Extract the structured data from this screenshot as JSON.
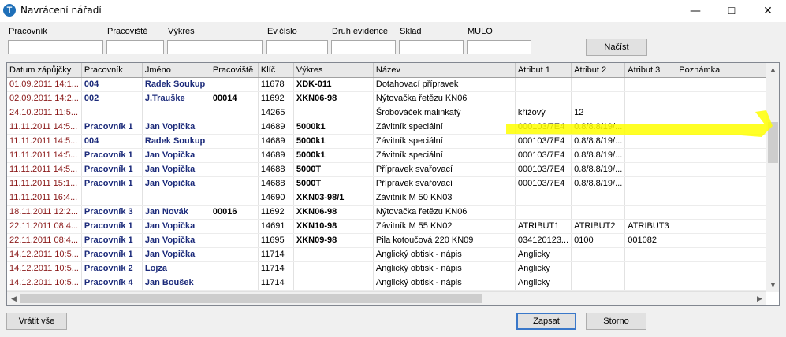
{
  "window": {
    "title": "Navrácení nářadí",
    "app_icon": "tool-app-icon",
    "minimize": "—",
    "maximize": "☐",
    "close": "✕"
  },
  "filters": {
    "pracovnik": {
      "label": "Pracovník",
      "value": ""
    },
    "pracoviste": {
      "label": "Pracoviště",
      "value": ""
    },
    "vykres": {
      "label": "Výkres",
      "value": ""
    },
    "evcislo": {
      "label": "Ev.číslo",
      "value": ""
    },
    "druh": {
      "label": "Druh evidence",
      "value": ""
    },
    "sklad": {
      "label": "Sklad",
      "value": ""
    },
    "mulo": {
      "label": "MULO",
      "value": ""
    },
    "load_button": "Načíst"
  },
  "grid": {
    "columns": [
      "Datum zápůjčky",
      "Pracovník",
      "Jméno",
      "Pracoviště",
      "Klíč",
      "Výkres",
      "Název",
      "Atribut 1",
      "Atribut 2",
      "Atribut 3",
      "Poznámka"
    ],
    "rows": [
      [
        "01.09.2011 14:1...",
        "004",
        "Radek Soukup",
        "",
        "11678",
        "XDK-011",
        "Dotahovací přípravek",
        "",
        "",
        "",
        ""
      ],
      [
        "02.09.2011 14:2...",
        "002",
        "J.Trauške",
        "00014",
        "11692",
        "XKN06-98",
        "Nýtovačka řetězu KN06",
        "",
        "",
        "",
        ""
      ],
      [
        "24.10.2011 11:5...",
        "",
        "",
        "",
        "14265",
        "",
        "Šrobováček malinkatý",
        "křížový",
        "12",
        "",
        ""
      ],
      [
        "11.11.2011 14:5...",
        "Pracovník 1",
        "Jan Vopička",
        "",
        "14689",
        "5000k1",
        "Závitník speciální",
        "000103/7E4",
        "0.8/8.8/19/...",
        "",
        ""
      ],
      [
        "11.11.2011 14:5...",
        "004",
        "Radek Soukup",
        "",
        "14689",
        "5000k1",
        "Závitník speciální",
        "000103/7E4",
        "0.8/8.8/19/...",
        "",
        ""
      ],
      [
        "11.11.2011 14:5...",
        "Pracovník 1",
        "Jan Vopička",
        "",
        "14689",
        "5000k1",
        "Závitník speciální",
        "000103/7E4",
        "0.8/8.8/19/...",
        "",
        ""
      ],
      [
        "11.11.2011 14:5...",
        "Pracovník 1",
        "Jan Vopička",
        "",
        "14688",
        "5000T",
        "Přípravek svařovací",
        "000103/7E4",
        "0.8/8.8/19/...",
        "",
        ""
      ],
      [
        "11.11.2011 15:1...",
        "Pracovník 1",
        "Jan Vopička",
        "",
        "14688",
        "5000T",
        "Přípravek svařovací",
        "000103/7E4",
        "0.8/8.8/19/...",
        "",
        ""
      ],
      [
        "11.11.2011 16:4...",
        "",
        "",
        "",
        "14690",
        "XKN03-98/1",
        "Závitník M 50 KN03",
        "",
        "",
        "",
        ""
      ],
      [
        "18.11.2011 12:2...",
        "Pracovník 3",
        "Jan Novák",
        "00016",
        "11692",
        "XKN06-98",
        "Nýtovačka řetězu KN06",
        "",
        "",
        "",
        ""
      ],
      [
        "22.11.2011 08:4...",
        "Pracovník 1",
        "Jan Vopička",
        "",
        "14691",
        "XKN10-98",
        "Závitník M 55 KN02",
        "ATRIBUT1",
        "ATRIBUT2",
        "ATRIBUT3",
        ""
      ],
      [
        "22.11.2011 08:4...",
        "Pracovník 1",
        "Jan Vopička",
        "",
        "11695",
        "XKN09-98",
        "Pila kotoučová 220 KN09",
        "034120123...",
        "0100",
        "001082",
        ""
      ],
      [
        "14.12.2011 10:5...",
        "Pracovník 1",
        "Jan Vopička",
        "",
        "11714",
        "",
        "Anglický obtisk - nápis",
        "Anglicky",
        "",
        "",
        ""
      ],
      [
        "14.12.2011 10:5...",
        "Pracovník 2",
        "Lojza",
        "",
        "11714",
        "",
        "Anglický obtisk - nápis",
        "Anglicky",
        "",
        "",
        ""
      ],
      [
        "14.12.2011 10:5...",
        "Pracovník 4",
        "Jan Boušek",
        "",
        "11714",
        "",
        "Anglický obtisk - nápis",
        "Anglicky",
        "",
        "",
        ""
      ]
    ]
  },
  "scroll": {
    "up": "▲",
    "down": "▼",
    "left": "◀",
    "right": "▶"
  },
  "buttons": {
    "return_all": "Vrátit vše",
    "save": "Zapsat",
    "cancel": "Storno"
  },
  "colors": {
    "date_text": "#8b1a1a",
    "worker_text": "#1b2a7a",
    "highlight": "#ffff00",
    "default_button_border": "#3a78c9"
  }
}
